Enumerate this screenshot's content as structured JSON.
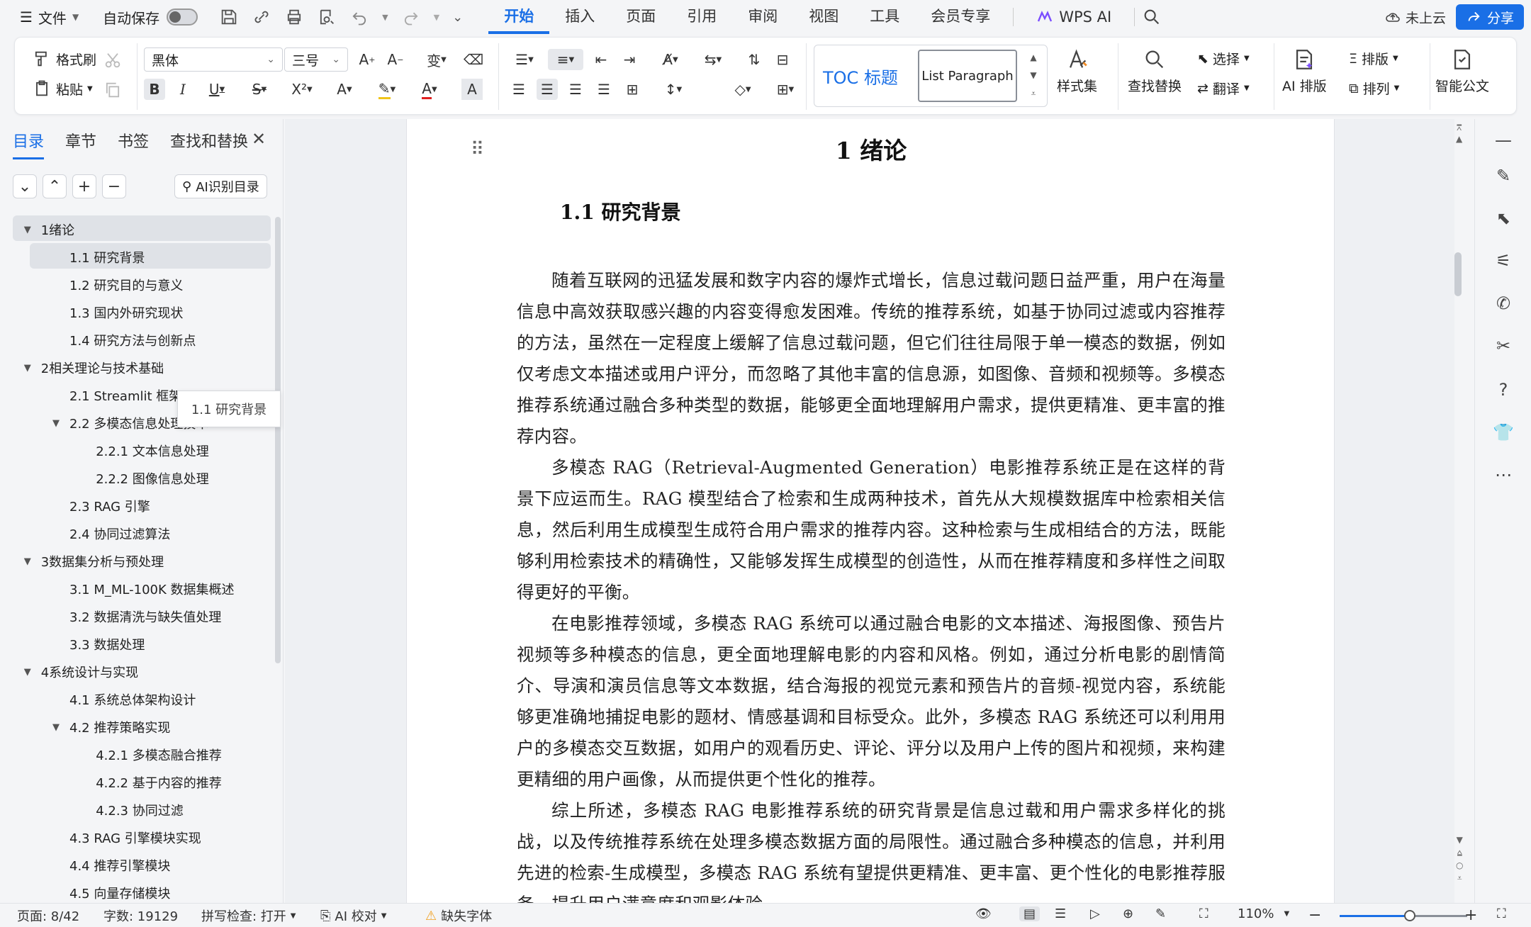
{
  "menu": {
    "file_label": "文件",
    "autosave_label": "自动保存",
    "tabs": [
      "开始",
      "插入",
      "页面",
      "引用",
      "审阅",
      "视图",
      "工具",
      "会员专享"
    ],
    "wps_ai": "WPS AI",
    "cloud_label": "未上云",
    "share_label": "分享"
  },
  "ribbon": {
    "format_painter": "格式刷",
    "paste": "粘贴",
    "font_name": "黑体",
    "font_size": "三号",
    "toc_style": "TOC 标题",
    "list_style": "List Paragraph",
    "style_set": "样式集",
    "find_replace": "查找替换",
    "select": "选择",
    "translate": "翻译",
    "ai_layout": "AI 排版",
    "typeset": "排版",
    "arrange": "排列",
    "smart_doc": "智能公文"
  },
  "nav": {
    "tabs": [
      "目录",
      "章节",
      "书签",
      "查找和替换"
    ],
    "ai_toc": "AI识别目录",
    "tooltip": "1.1 研究背景",
    "items": [
      {
        "label": "1绪论",
        "level": 0,
        "caret": "▼"
      },
      {
        "label": "1.1  研究背景",
        "level": 1,
        "caret": ""
      },
      {
        "label": "1.2  研究目的与意义",
        "level": 1,
        "caret": ""
      },
      {
        "label": "1.3  国内外研究现状",
        "level": 1,
        "caret": ""
      },
      {
        "label": "1.4  研究方法与创新点",
        "level": 1,
        "caret": ""
      },
      {
        "label": "2相关理论与技术基础",
        "level": 0,
        "caret": "▼"
      },
      {
        "label": "2.1 Streamlit  框架",
        "level": 1,
        "caret": ""
      },
      {
        "label": "2.2  多模态信息处理技术",
        "level": 1,
        "caret": "▼"
      },
      {
        "label": "2.2.1  文本信息处理",
        "level": 2,
        "caret": ""
      },
      {
        "label": "2.2.2  图像信息处理",
        "level": 2,
        "caret": ""
      },
      {
        "label": "2.3 RAG 引擎",
        "level": 1,
        "caret": ""
      },
      {
        "label": "2.4  协同过滤算法",
        "level": 1,
        "caret": ""
      },
      {
        "label": "3数据集分析与预处理",
        "level": 0,
        "caret": "▼"
      },
      {
        "label": "3.1 M_ML-100K  数据集概述",
        "level": 1,
        "caret": ""
      },
      {
        "label": "3.2  数据清洗与缺失值处理",
        "level": 1,
        "caret": ""
      },
      {
        "label": "3.3  数据处理",
        "level": 1,
        "caret": ""
      },
      {
        "label": "4系统设计与实现",
        "level": 0,
        "caret": "▼"
      },
      {
        "label": "4.1  系统总体架构设计",
        "level": 1,
        "caret": ""
      },
      {
        "label": "4.2  推荐策略实现",
        "level": 1,
        "caret": "▼"
      },
      {
        "label": "4.2.1  多模态融合推荐",
        "level": 2,
        "caret": ""
      },
      {
        "label": "4.2.2  基于内容的推荐",
        "level": 2,
        "caret": ""
      },
      {
        "label": "4.2.3  协同过滤",
        "level": 2,
        "caret": ""
      },
      {
        "label": "4.3 RAG 引擎模块实现",
        "level": 1,
        "caret": ""
      },
      {
        "label": "4.4  推荐引擎模块",
        "level": 1,
        "caret": ""
      },
      {
        "label": "4.5  向量存储模块",
        "level": 1,
        "caret": ""
      }
    ]
  },
  "doc": {
    "h1": "1    绪论",
    "h2": "1.1  研究背景",
    "paragraphs": [
      "随着互联网的迅猛发展和数字内容的爆炸式增长，信息过载问题日益严重，用户在海量信息中高效获取感兴趣的内容变得愈发困难。传统的推荐系统，如基于协同过滤或内容推荐的方法，虽然在一定程度上缓解了信息过载问题，但它们往往局限于单一模态的数据，例如仅考虑文本描述或用户评分，而忽略了其他丰富的信息源，如图像、音频和视频等。多模态推荐系统通过融合多种类型的数据，能够更全面地理解用户需求，提供更精准、更丰富的推荐内容。",
      "多模态 RAG（Retrieval-Augmented Generation）电影推荐系统正是在这样的背景下应运而生。RAG 模型结合了检索和生成两种技术，首先从大规模数据库中检索相关信息，然后利用生成模型生成符合用户需求的推荐内容。这种检索与生成相结合的方法，既能够利用检索技术的精确性，又能够发挥生成模型的创造性，从而在推荐精度和多样性之间取得更好的平衡。",
      "在电影推荐领域，多模态 RAG 系统可以通过融合电影的文本描述、海报图像、预告片视频等多种模态的信息，更全面地理解电影的内容和风格。例如，通过分析电影的剧情简介、导演和演员信息等文本数据，结合海报的视觉元素和预告片的音频-视觉内容，系统能够更准确地捕捉电影的题材、情感基调和目标受众。此外，多模态 RAG 系统还可以利用用户的多模态交互数据，如用户的观看历史、评论、评分以及用户上传的图片和视频，来构建更精细的用户画像，从而提供更个性化的推荐。",
      "综上所述，多模态 RAG 电影推荐系统的研究背景是信息过载和用户需求多样化的挑战，以及传统推荐系统在处理多模态数据方面的局限性。通过融合多种模态的信息，并利用先进的检索-生成模型，多模态 RAG 系统有望提供更精准、更丰富、更个性化的电影推荐服务，提升用户满意度和观影体验。"
    ]
  },
  "status": {
    "page": "页面: 8/42",
    "words": "字数: 19129",
    "spell": "拼写检查: 打开",
    "ai_check": "AI 校对",
    "missing_font": "缺失字体",
    "zoom": "110%",
    "zoom_fraction": 0.55
  },
  "colors": {
    "accent": "#1a6fe6",
    "ai_purple": "#7b4dff"
  }
}
